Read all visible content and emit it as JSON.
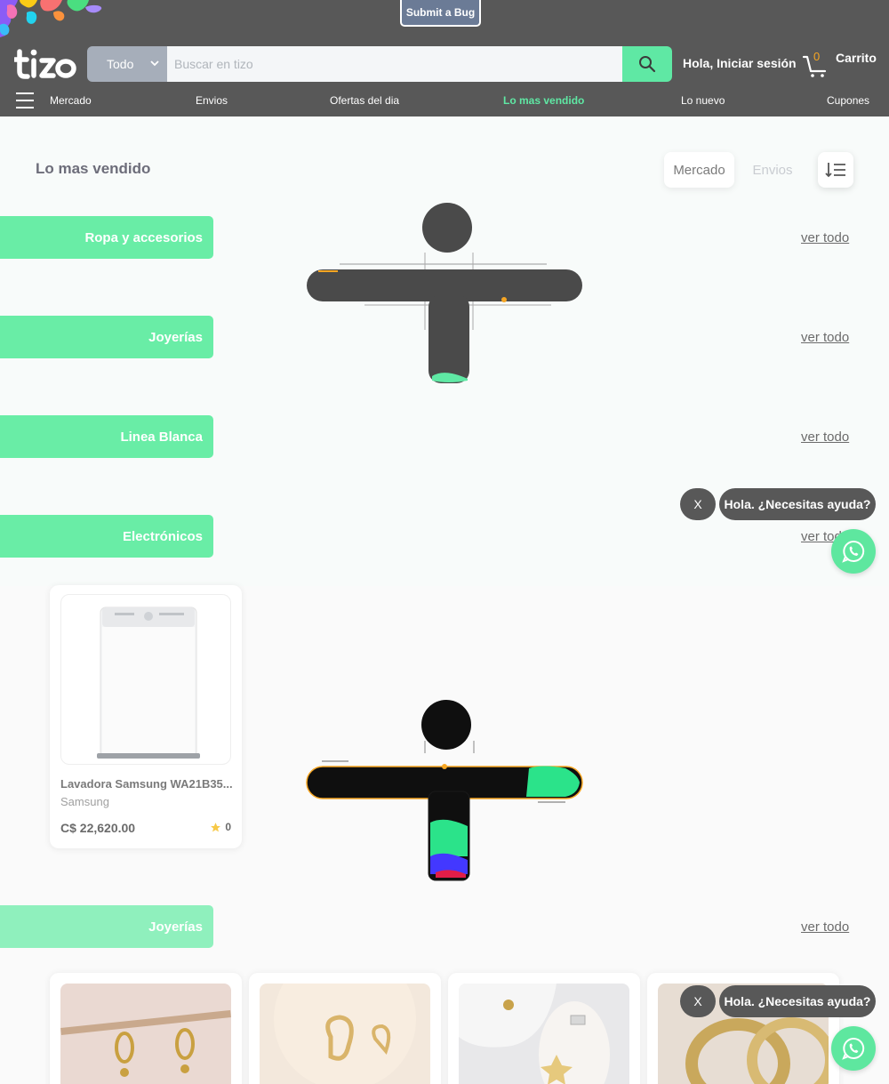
{
  "header": {
    "bug_button": "Submit a Bug",
    "search_category": "Todo",
    "search_placeholder": "Buscar en tizo",
    "signin": "Hola, Iniciar sesión",
    "cart_count": "0",
    "cart_label": "Carrito",
    "accent_color": "#5fe8a4"
  },
  "nav": {
    "items": [
      {
        "label": "Mercado"
      },
      {
        "label": "Envios"
      },
      {
        "label": "Ofertas del dia"
      },
      {
        "label": "Lo mas vendido",
        "active": true
      },
      {
        "label": "Lo nuevo"
      },
      {
        "label": "Cupones"
      }
    ]
  },
  "page": {
    "title": "Lo mas vendido",
    "filters": [
      "Mercado",
      "Envios"
    ],
    "sort_icon": "sort-list-icon"
  },
  "categories": [
    {
      "name": "Ropa y accesorios",
      "link": "ver todo"
    },
    {
      "name": "Joyerías",
      "link": "ver todo"
    },
    {
      "name": "Linea Blanca",
      "link": "ver todo"
    },
    {
      "name": "Electrónicos",
      "link": "ver todo"
    }
  ],
  "products": [
    {
      "name": "Lavadora Samsung WA21B35...",
      "brand": "Samsung",
      "price": "C$ 22,620.00",
      "rating": "0"
    }
  ],
  "section2": {
    "name": "Joyerías",
    "link": "ver todo"
  },
  "chat": {
    "close": "X",
    "message": "Hola. ¿Necesitas ayuda?"
  }
}
